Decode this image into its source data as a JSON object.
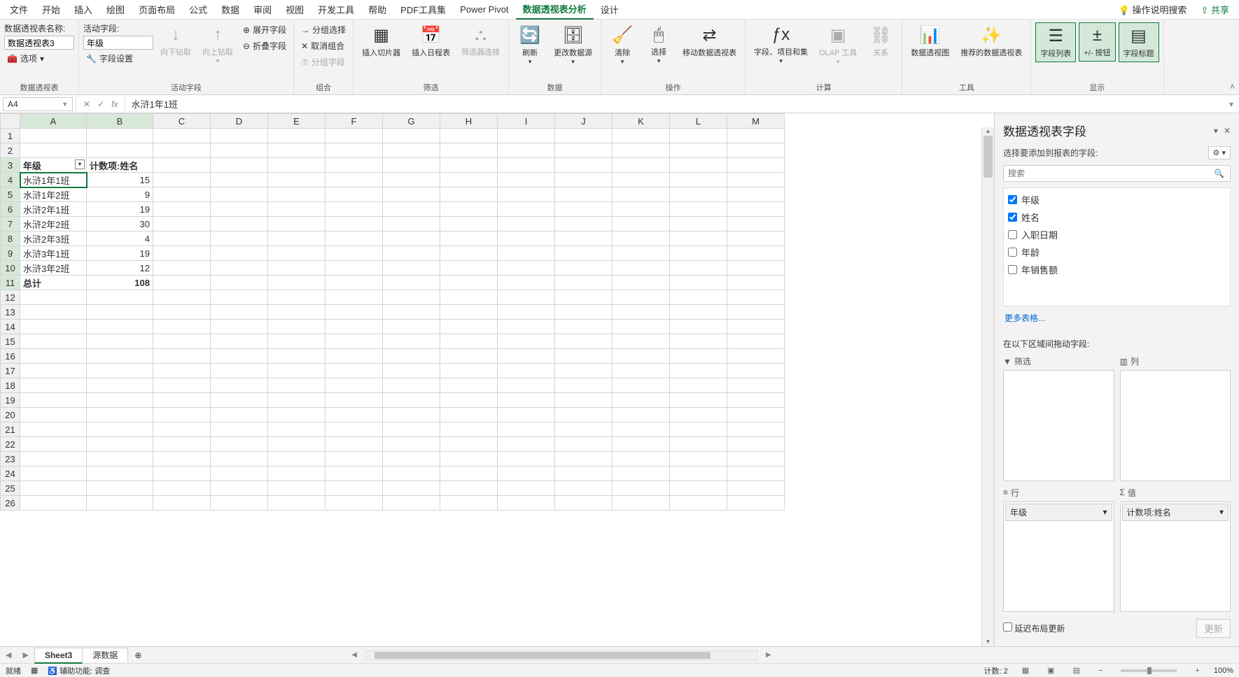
{
  "menu": {
    "items": [
      "文件",
      "开始",
      "插入",
      "绘图",
      "页面布局",
      "公式",
      "数据",
      "审阅",
      "视图",
      "开发工具",
      "帮助",
      "PDF工具集",
      "Power Pivot",
      "数据透视表分析",
      "设计"
    ],
    "active_index": 13,
    "tell_me": "操作说明搜索",
    "share": "共享"
  },
  "ribbon": {
    "g1_label": "数据透视表",
    "pt_name_label": "数据透视表名称:",
    "pt_name_value": "数据透视表3",
    "options_btn": "选项",
    "g2_label": "活动字段",
    "active_field_label": "活动字段:",
    "active_field_value": "年级",
    "field_settings": "字段设置",
    "drill_down": "向下钻取",
    "drill_up": "向上钻取",
    "expand_field": "展开字段",
    "collapse_field": "折叠字段",
    "g3_label": "组合",
    "group_sel": "分组选择",
    "ungroup": "取消组合",
    "group_field": "分组字段",
    "g4_label": "筛选",
    "slicer": "插入切片器",
    "timeline": "插入日程表",
    "filter_conn": "筛选器连接",
    "g5_label": "数据",
    "refresh": "刷新",
    "change_src": "更改数据源",
    "g6_label": "操作",
    "clear": "清除",
    "select": "选择",
    "move": "移动数据透视表",
    "g7_label": "计算",
    "calc_fields": "字段、项目和集",
    "olap": "OLAP 工具",
    "relations": "关系",
    "g8_label": "工具",
    "pivot_chart": "数据透视图",
    "recommended": "推荐的数据透视表",
    "g9_label": "显示",
    "field_list_btn": "字段列表",
    "buttons_btn": "+/- 按钮",
    "headers_btn": "字段标题"
  },
  "formula_bar": {
    "namebox": "A4",
    "formula": "水浒1年1班"
  },
  "columns": [
    "A",
    "B",
    "C",
    "D",
    "E",
    "F",
    "G",
    "H",
    "I",
    "J",
    "K",
    "L",
    "M"
  ],
  "pivot": {
    "hdr_row_label": "年级",
    "hdr_value_label": "计数项:姓名",
    "rows": [
      {
        "label": "水浒1年1班",
        "value": "15"
      },
      {
        "label": "水浒1年2班",
        "value": "9"
      },
      {
        "label": "水浒2年1班",
        "value": "19"
      },
      {
        "label": "水浒2年2班",
        "value": "30"
      },
      {
        "label": "水浒2年3班",
        "value": "4"
      },
      {
        "label": "水浒3年1班",
        "value": "19"
      },
      {
        "label": "水浒3年2班",
        "value": "12"
      }
    ],
    "total_label": "总计",
    "total_value": "108"
  },
  "pane": {
    "title": "数据透视表字段",
    "choose": "选择要添加到报表的字段:",
    "search_placeholder": "搜索",
    "fields": [
      {
        "label": "年级",
        "checked": true
      },
      {
        "label": "姓名",
        "checked": true
      },
      {
        "label": "入职日期",
        "checked": false
      },
      {
        "label": "年龄",
        "checked": false
      },
      {
        "label": "年销售额",
        "checked": false
      }
    ],
    "more_tables": "更多表格...",
    "drag_label": "在以下区域间拖动字段:",
    "filter_title": "筛选",
    "columns_title": "列",
    "rows_title": "行",
    "values_title": "值",
    "row_pill": "年级",
    "value_pill": "计数项:姓名",
    "defer_label": "延迟布局更新",
    "update_btn": "更新"
  },
  "sheets": {
    "tabs": [
      "Sheet3",
      "源数据"
    ],
    "active": 0
  },
  "status": {
    "ready": "就绪",
    "acc": "辅助功能: 调查",
    "count": "计数: 2",
    "zoom": "100%"
  }
}
